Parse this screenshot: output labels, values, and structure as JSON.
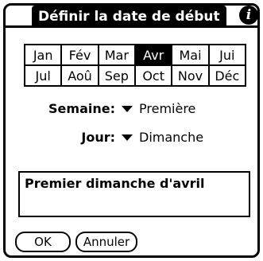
{
  "dialog": {
    "title": "Définir la date de début",
    "info_icon": "info-icon"
  },
  "months": [
    "Jan",
    "Fév",
    "Mar",
    "Avr",
    "Mai",
    "Jui",
    "Jul",
    "Aoû",
    "Sep",
    "Oct",
    "Nov",
    "Déc"
  ],
  "selected_month": "Avr",
  "week": {
    "label": "Semaine:",
    "value": "Première"
  },
  "day": {
    "label": "Jour:",
    "value": "Dimanche"
  },
  "result_text": "Premier dimanche d'avril",
  "buttons": {
    "ok": "OK",
    "cancel": "Annuler"
  }
}
